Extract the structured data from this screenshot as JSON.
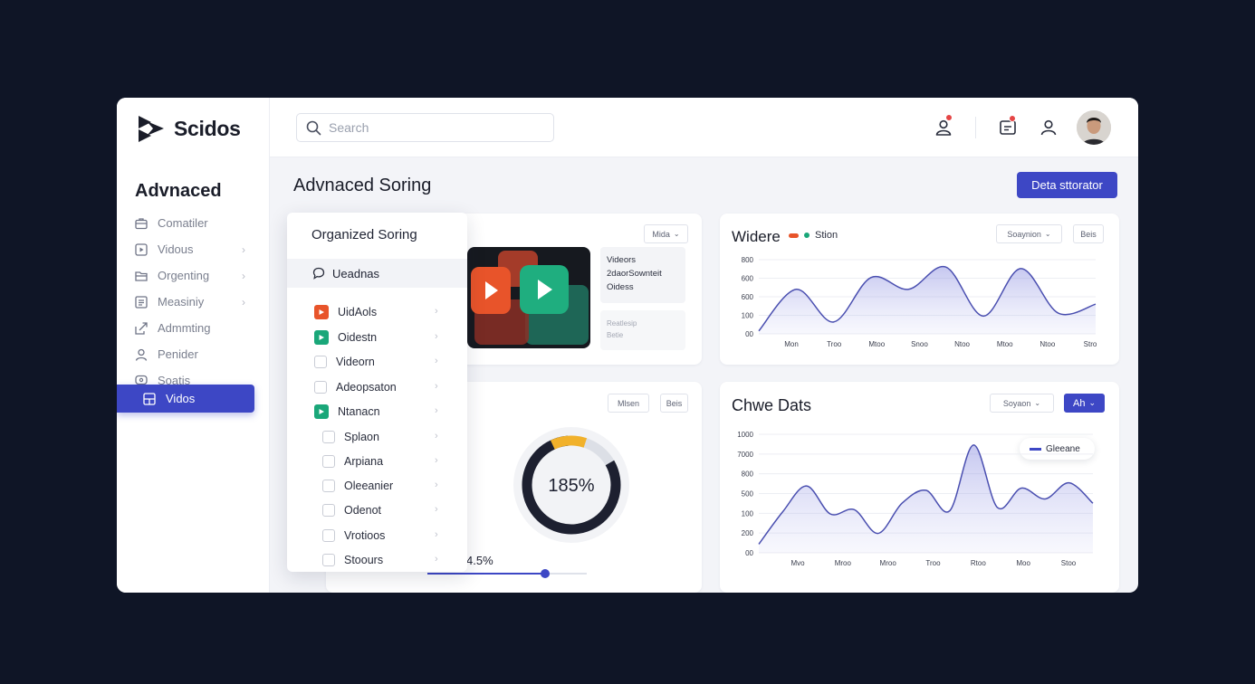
{
  "app": {
    "name": "Scidos"
  },
  "sidebar": {
    "section_title": "Advnaced",
    "items": [
      {
        "label": "Comatiler",
        "icon": "briefcase-icon",
        "chevron": false
      },
      {
        "label": "Vidous",
        "icon": "video-icon",
        "chevron": true
      },
      {
        "label": "Orgenting",
        "icon": "folder-icon",
        "chevron": true
      },
      {
        "label": "Measiniy",
        "icon": "list-icon",
        "chevron": true
      },
      {
        "label": "Admmting",
        "icon": "share-icon",
        "chevron": false
      },
      {
        "label": "Penider",
        "icon": "user-icon",
        "chevron": false
      },
      {
        "label": "Soatis",
        "icon": "comment-icon",
        "chevron": false
      }
    ],
    "active_item": {
      "label": "Vidos",
      "icon": "grid-icon"
    }
  },
  "topbar": {
    "search_placeholder": "Search"
  },
  "page": {
    "title": "Advnaced Soring",
    "primary_button": "Deta sttorator"
  },
  "popup": {
    "title": "Organized Soring",
    "selected": "Ueadnas",
    "items": [
      {
        "label": "UidAols",
        "color": "#e8542a"
      },
      {
        "label": "Oidestn",
        "color": "#1aa779"
      },
      {
        "label": "Videorn",
        "color": "none"
      },
      {
        "label": "Adeopsaton",
        "color": "none"
      },
      {
        "label": "Ntanacn",
        "color": "#1aa779"
      },
      {
        "label": "Splaon",
        "color": "none"
      },
      {
        "label": "Arpiana",
        "color": "none"
      },
      {
        "label": "Oleeanier",
        "color": "none"
      },
      {
        "label": "Odenot",
        "color": "none"
      },
      {
        "label": "Vrotioos",
        "color": "none"
      },
      {
        "label": "Stoours",
        "color": "none"
      }
    ]
  },
  "video_card": {
    "button": "Mida",
    "info_lines": [
      "Videors",
      "2daorSownteit",
      "Oidess"
    ],
    "info2_lines": [
      "Reatlesip",
      "Betie"
    ]
  },
  "donut_card": {
    "buttons": [
      "Mlsen",
      "Beis"
    ],
    "center_value": "185%",
    "slider_label": "4.5%",
    "progress": 0.12,
    "slider_position": 0.74
  },
  "chart1": {
    "title": "Widere",
    "legend": [
      {
        "label": "Stion",
        "color": "#1aa779"
      }
    ],
    "legend_accent": "#e8542a",
    "dropdown": "Soaynion",
    "button": "Beis"
  },
  "chart2": {
    "title": "Chwe Dats",
    "dropdown": "Soyaon",
    "dropdown2": "Ah",
    "legend": "Gleeane"
  },
  "chart_data": [
    {
      "type": "area",
      "title": "Widere",
      "x": [
        "Mon",
        "Troo",
        "Mtoo",
        "Snoo",
        "Ntoo",
        "Mtoo",
        "Ntoo",
        "Stro"
      ],
      "y_ticks": [
        "800",
        "600",
        "600",
        "100",
        "00"
      ],
      "series": [
        {
          "name": "Stion",
          "values": [
            20,
            300,
            80,
            380,
            300,
            450,
            120,
            440,
            140,
            200
          ]
        }
      ],
      "ylim": [
        0,
        500
      ]
    },
    {
      "type": "area",
      "title": "Chwe Dats",
      "x": [
        "Mvo",
        "Mroo",
        "Mroo",
        "Troo",
        "Rtoo",
        "Moo",
        "Stoo"
      ],
      "y_ticks": [
        "1000",
        "7000",
        "800",
        "500",
        "100",
        "200",
        "00"
      ],
      "series": [
        {
          "name": "Gleeane",
          "values": [
            80,
            380,
            620,
            360,
            400,
            180,
            460,
            580,
            390,
            1000,
            420,
            600,
            500,
            650,
            460
          ]
        }
      ],
      "ylim": [
        0,
        1100
      ]
    }
  ]
}
